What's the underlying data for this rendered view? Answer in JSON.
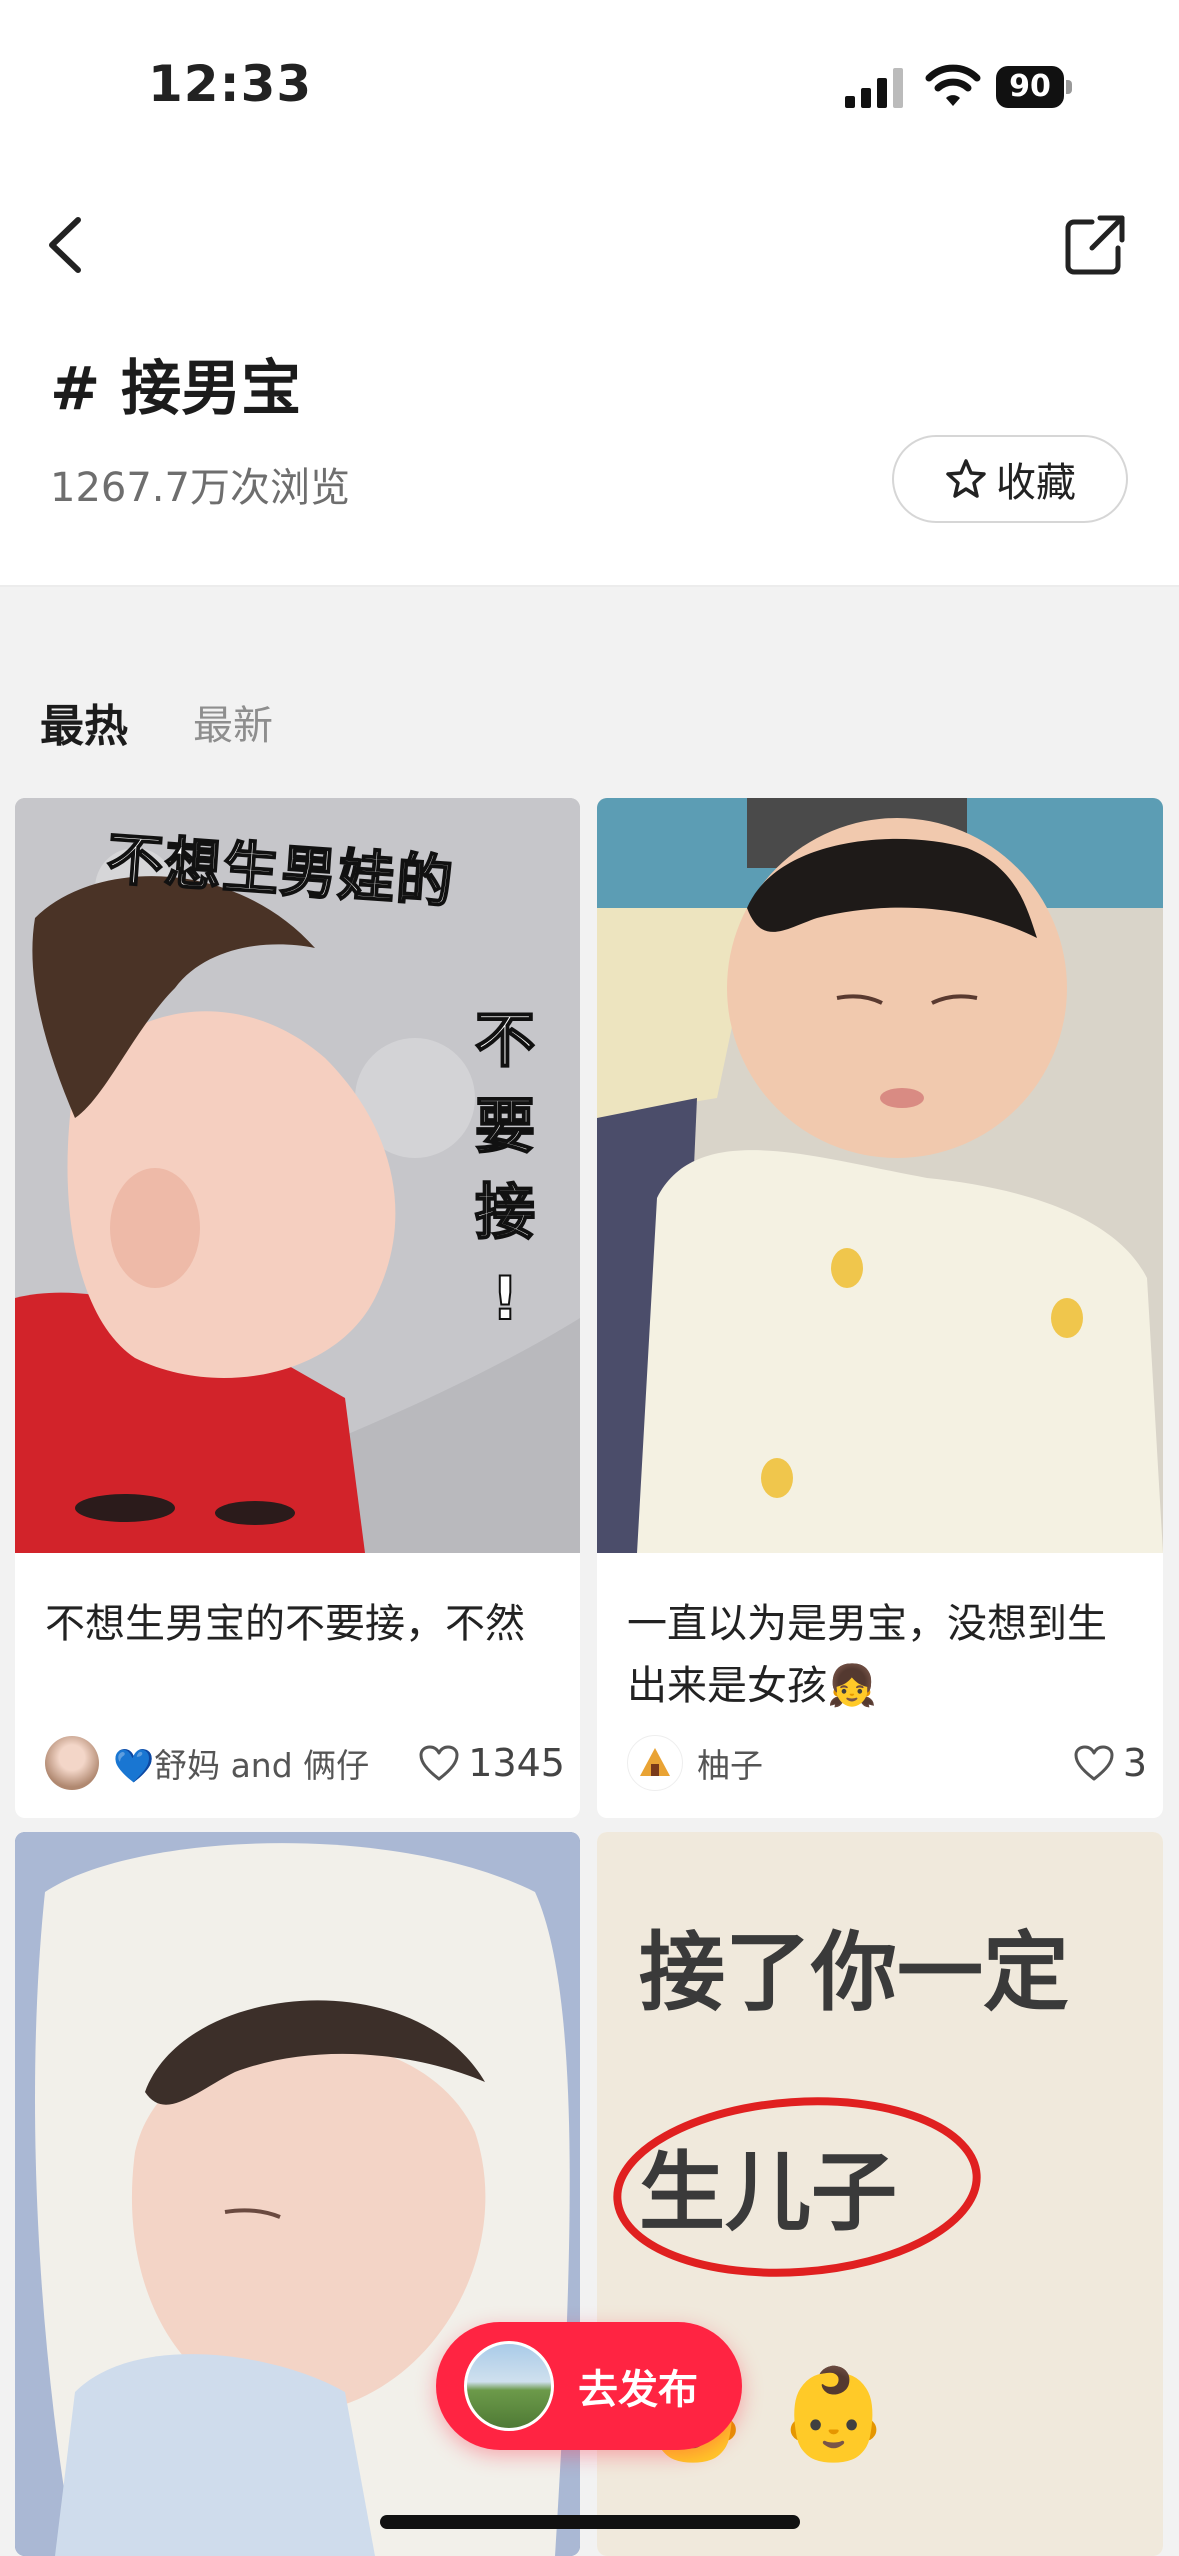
{
  "status_bar": {
    "time": "12:33",
    "battery": "90"
  },
  "header": {
    "title": "# 接男宝",
    "views": "1267.7万次浏览",
    "favorite_label": "收藏"
  },
  "tabs": {
    "hot": "最热",
    "new": "最新"
  },
  "posts": [
    {
      "image_text": [
        "不想生男娃的",
        "不",
        "要",
        "接",
        "!"
      ],
      "title": "不想生男宝的不要接，不然",
      "author": "💙舒妈 and 俩仔",
      "likes": "1345"
    },
    {
      "title": "一直以为是男宝，没想到生出来是女孩👧",
      "author": "柚子",
      "likes": "3"
    },
    {
      "image_text": []
    },
    {
      "image_text": [
        "接了你一定",
        "生儿子"
      ]
    }
  ],
  "publish_button": {
    "label": "去发布"
  },
  "colors": {
    "accent": "#ff2442",
    "background": "#f2f2f2"
  }
}
